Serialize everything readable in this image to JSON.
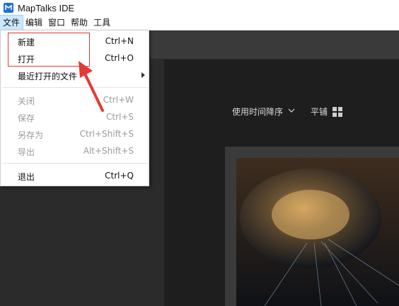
{
  "window": {
    "title": "MapTalks IDE"
  },
  "menubar": {
    "items": [
      "文件",
      "编辑",
      "窗口",
      "帮助",
      "工具"
    ]
  },
  "file_menu": {
    "items": [
      {
        "label": "新建",
        "shortcut": "Ctrl+N",
        "enabled": true
      },
      {
        "label": "打开",
        "shortcut": "Ctrl+O",
        "enabled": true
      },
      {
        "label": "最近打开的文件",
        "shortcut": "",
        "enabled": true,
        "submenu": true
      },
      {
        "label": "关闭",
        "shortcut": "Ctrl+W",
        "enabled": false
      },
      {
        "label": "保存",
        "shortcut": "Ctrl+S",
        "enabled": false
      },
      {
        "label": "另存为",
        "shortcut": "Ctrl+Shift+S",
        "enabled": false
      },
      {
        "label": "导出",
        "shortcut": "Alt+Shift+S",
        "enabled": false
      },
      {
        "label": "退出",
        "shortcut": "Ctrl+Q",
        "enabled": true
      }
    ]
  },
  "toolbar": {
    "sort_label": "使用时间降序",
    "view_label": "平铺"
  },
  "icons": {
    "logo": "maptalks-logo-icon",
    "sort": "chevron-down-icon",
    "view": "grid-icon"
  },
  "colors": {
    "accent": "#e53935",
    "logo": "#1e6fd9",
    "menu_selected": "#cce8ff"
  }
}
